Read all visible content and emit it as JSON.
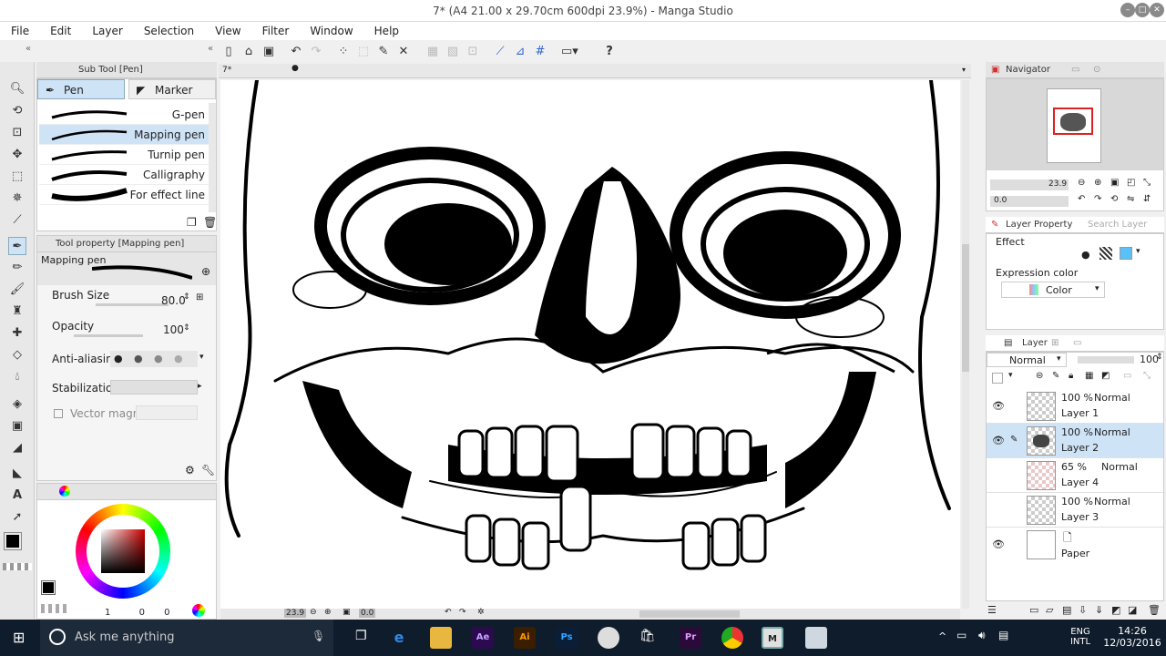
{
  "window": {
    "title": "7* (A4 21.00 x 29.70cm 600dpi 23.9%) - Manga Studio"
  },
  "menu": [
    "File",
    "Edit",
    "Layer",
    "Selection",
    "View",
    "Filter",
    "Window",
    "Help"
  ],
  "subtool": {
    "header": "Sub Tool [Pen]",
    "tabs": [
      "Pen",
      "Marker"
    ],
    "brushes": [
      "G-pen",
      "Mapping pen",
      "Turnip pen",
      "Calligraphy",
      "For effect line"
    ]
  },
  "toolprop": {
    "header": "Tool property [Mapping pen]",
    "preview_label": "Mapping pen",
    "brush_size_label": "Brush Size",
    "brush_size_value": "80.0",
    "opacity_label": "Opacity",
    "opacity_value": "100",
    "antialias_label": "Anti-aliasing",
    "stabilization_label": "Stabilization",
    "vector_magnet_label": "Vector magnet"
  },
  "color": {
    "primary": "#000000",
    "secondary": "#ffffff",
    "readout": [
      "1",
      "0",
      "0"
    ]
  },
  "canvas": {
    "doc_tab": "7*",
    "zoom": "23.9",
    "rotation": "0.0"
  },
  "navigator": {
    "header": "Navigator",
    "zoom": "23.9",
    "angle": "0.0"
  },
  "layerprop": {
    "header": "Layer Property",
    "search_tab": "Search Layer",
    "effect_label": "Effect",
    "expression_label": "Expression color",
    "expression_value": "Color"
  },
  "layers": {
    "header": "Layer",
    "blend_mode": "Normal",
    "opacity": "100",
    "items": [
      {
        "opacity": "100 %",
        "mode": "Normal",
        "name": "Layer 1",
        "visible": true,
        "selected": false
      },
      {
        "opacity": "100 %",
        "mode": "Normal",
        "name": "Layer 2",
        "visible": true,
        "selected": true
      },
      {
        "opacity": "65 %",
        "mode": "Normal",
        "name": "Layer 4",
        "visible": false,
        "selected": false
      },
      {
        "opacity": "100 %",
        "mode": "Normal",
        "name": "Layer 3",
        "visible": false,
        "selected": false
      },
      {
        "opacity": "",
        "mode": "",
        "name": "Paper",
        "visible": true,
        "selected": false
      }
    ]
  },
  "taskbar": {
    "search_placeholder": "Ask me anything",
    "apps": [
      "Ae",
      "Ai",
      "Ps",
      "Pr",
      "M"
    ],
    "lang": "ENG",
    "region": "INTL",
    "time": "14:26",
    "date": "12/03/2016"
  }
}
